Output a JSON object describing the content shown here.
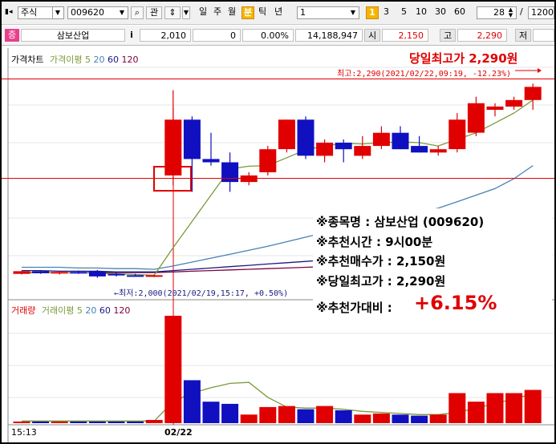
{
  "toolbar": {
    "market": "주식",
    "code": "009620",
    "watch_label": "관",
    "periods": [
      "일",
      "주",
      "월",
      "분",
      "틱",
      "년"
    ],
    "interval_value": "1",
    "interval_badge": "1",
    "intervals": [
      "3",
      "5",
      "10",
      "30",
      "60"
    ],
    "bar_count": "28",
    "slash": "/",
    "total": "1200"
  },
  "info": {
    "badge": "증",
    "name": "삼보산업",
    "info_button": "i",
    "price": "2,010",
    "change": "0",
    "rate": "0.00%",
    "volume": "14,188,947",
    "open_label": "시",
    "open": "2,150",
    "high_label": "고",
    "high": "2,290",
    "low_label": "저"
  },
  "price_panel": {
    "legend": [
      "가격차트",
      "가격이평",
      "5",
      "20",
      "60",
      "120"
    ],
    "max_title": "당일최고가 2,290원",
    "max_note": "최고:2,290(2021/02/22,09:19, -12.23%)",
    "min_note": "최저:2,000(2021/02/19,15:17, +0.50%)"
  },
  "volume_panel": {
    "legend": [
      "거래량",
      "거래이평",
      "5",
      "20",
      "60",
      "120"
    ]
  },
  "time_axis": {
    "left_label": "15:13",
    "date_label": "02/22"
  },
  "annotation": {
    "stock": "※종목명 : 삼보산업 (009620)",
    "time": "※추천시간 : 9시00분",
    "buy": "※추천매수가 : 2,150원",
    "max": "※당일최고가 : 2,290원",
    "ratio_label": "※추천가대비 : ",
    "ratio_value": "+6.15%"
  },
  "colors": {
    "up": "#e00000",
    "down": "#1010c0",
    "ma5": "#7a9a3a",
    "ma20": "#4682b4",
    "ma60": "#1a1a80",
    "ma120": "#800040",
    "accent": "#f5b500"
  },
  "chart_data": {
    "type": "candlestick",
    "x_labels": [
      "15:13",
      "02/22"
    ],
    "price_range": [
      1985,
      2305
    ],
    "candles": [
      {
        "o": 2000,
        "h": 2005,
        "l": 1999,
        "c": 2004
      },
      {
        "o": 2004,
        "h": 2005,
        "l": 2000,
        "c": 2001
      },
      {
        "o": 2001,
        "h": 2004,
        "l": 1999,
        "c": 2003
      },
      {
        "o": 2003,
        "h": 2005,
        "l": 2000,
        "c": 2002
      },
      {
        "o": 2004,
        "h": 2006,
        "l": 1994,
        "c": 1996
      },
      {
        "o": 2000,
        "h": 2002,
        "l": 1996,
        "c": 1998
      },
      {
        "o": 1998,
        "h": 2000,
        "l": 1996,
        "c": 1997
      },
      {
        "o": 1997,
        "h": 1999,
        "l": 1995,
        "c": 1998
      },
      {
        "o": 2150,
        "h": 2280,
        "l": 2135,
        "c": 2235
      },
      {
        "o": 2235,
        "h": 2240,
        "l": 2125,
        "c": 2175
      },
      {
        "o": 2175,
        "h": 2215,
        "l": 2165,
        "c": 2170
      },
      {
        "o": 2170,
        "h": 2185,
        "l": 2125,
        "c": 2140
      },
      {
        "o": 2140,
        "h": 2155,
        "l": 2135,
        "c": 2150
      },
      {
        "o": 2155,
        "h": 2195,
        "l": 2150,
        "c": 2190
      },
      {
        "o": 2190,
        "h": 2235,
        "l": 2185,
        "c": 2235
      },
      {
        "o": 2235,
        "h": 2240,
        "l": 2175,
        "c": 2180
      },
      {
        "o": 2180,
        "h": 2205,
        "l": 2170,
        "c": 2200
      },
      {
        "o": 2200,
        "h": 2205,
        "l": 2170,
        "c": 2190
      },
      {
        "o": 2180,
        "h": 2210,
        "l": 2175,
        "c": 2195
      },
      {
        "o": 2195,
        "h": 2225,
        "l": 2190,
        "c": 2215
      },
      {
        "o": 2215,
        "h": 2225,
        "l": 2190,
        "c": 2190
      },
      {
        "o": 2195,
        "h": 2210,
        "l": 2185,
        "c": 2185
      },
      {
        "o": 2185,
        "h": 2195,
        "l": 2180,
        "c": 2190
      },
      {
        "o": 2190,
        "h": 2245,
        "l": 2185,
        "c": 2235
      },
      {
        "o": 2215,
        "h": 2270,
        "l": 2210,
        "c": 2260
      },
      {
        "o": 2250,
        "h": 2260,
        "l": 2240,
        "c": 2255
      },
      {
        "o": 2255,
        "h": 2270,
        "l": 2250,
        "c": 2265
      },
      {
        "o": 2265,
        "h": 2290,
        "l": 2250,
        "c": 2285
      }
    ],
    "volume_range": [
      0,
      100
    ],
    "volumes": [
      1.5,
      1.5,
      1.5,
      1.5,
      1.5,
      1.5,
      1.5,
      3,
      100,
      40,
      20,
      18,
      8,
      15,
      16,
      13,
      16,
      12,
      8,
      9,
      8,
      7,
      8,
      28,
      20,
      28,
      28,
      31
    ],
    "moving_averages": {
      "price_ma5": [
        2001,
        2002,
        2002,
        2002,
        2001,
        2000,
        1999,
        1998,
        2040,
        2080,
        2120,
        2160,
        2164,
        2165,
        2177,
        2189,
        2195,
        2199,
        2198,
        2200,
        2201,
        2200,
        2195,
        2205,
        2215,
        2230,
        2245,
        2265
      ],
      "price_ma20": [
        2010,
        2010,
        2010,
        2009,
        2009,
        2008,
        2008,
        2007,
        2012,
        2018,
        2024,
        2030,
        2036,
        2042,
        2049,
        2056,
        2063,
        2069,
        2076,
        2082,
        2088,
        2094,
        2100,
        2110,
        2120,
        2130,
        2145,
        2165
      ],
      "price_ma60": [
        2005,
        2005,
        2004,
        2004,
        2004,
        2003,
        2003,
        2003,
        2005,
        2007,
        2009,
        2011,
        2013,
        2015,
        2017,
        2019,
        2021,
        2023,
        2025,
        2027,
        2029,
        2031,
        2033,
        2035,
        2037,
        2039,
        2041,
        2043
      ],
      "price_ma120": [
        2002,
        2002,
        2002,
        2002,
        2002,
        2002,
        2002,
        2002,
        2003,
        2004,
        2005,
        2006,
        2007,
        2008,
        2009,
        2010,
        2011,
        2012,
        2013,
        2014,
        2015,
        2016,
        2017,
        2018,
        2019,
        2020,
        2021,
        2022
      ],
      "volume_ma5": [
        2,
        2,
        2,
        2,
        2,
        2,
        2,
        2,
        20,
        28,
        33,
        37,
        38,
        24,
        15,
        14,
        14,
        13,
        11,
        10,
        9,
        8,
        8,
        10,
        14,
        18,
        23,
        27
      ]
    }
  }
}
